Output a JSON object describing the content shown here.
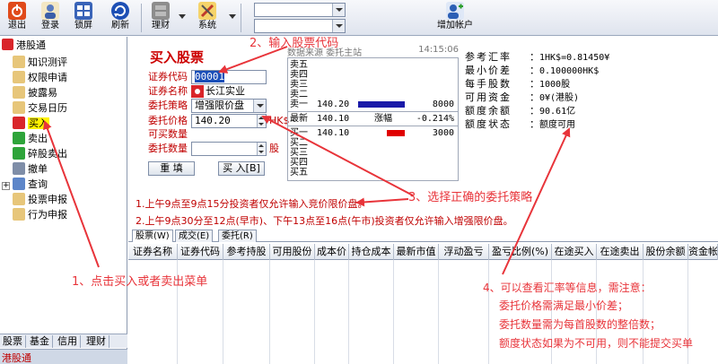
{
  "toolbar": {
    "buttons": [
      {
        "label": "退出",
        "icon": "power-icon"
      },
      {
        "label": "登录",
        "icon": "login-icon"
      },
      {
        "label": "锁屏",
        "icon": "lock-screen-icon"
      },
      {
        "label": "刷新",
        "icon": "refresh-icon"
      },
      {
        "label": "理财",
        "icon": "finance-icon"
      },
      {
        "label": "系统",
        "icon": "tools-icon"
      }
    ],
    "combo1": "",
    "combo2": "",
    "add_account": "增加帐户"
  },
  "tree": {
    "root": "港股通",
    "items": [
      "知识测评",
      "权限申请",
      "披露易",
      "交易日历",
      "买入",
      "卖出",
      "碎股卖出",
      "撤单",
      "查询",
      "投票申报",
      "行为申报"
    ],
    "selected": "买入"
  },
  "left_tabs": [
    "股票",
    "基金",
    "信用",
    "理财"
  ],
  "left_bottom": "港股通",
  "form": {
    "title": "买入股票",
    "code_label": "证券代码",
    "code_value": "00001",
    "name_label": "证券名称",
    "name_value": "长江实业",
    "strategy_label": "委托策略",
    "strategy_value": "增强限价盘",
    "price_label": "委托价格",
    "price_value": "140.20",
    "price_unit": "HK$",
    "max_label": "可买数量",
    "qty_label": "委托数量",
    "qty_value": "",
    "qty_unit": "股",
    "reset_button": "重 填",
    "buy_button": "买 入[B]"
  },
  "quote": {
    "source": "数据来源  委托主站",
    "time": "14:15:06",
    "sells": [
      {
        "label": "卖五",
        "price": "",
        "vol": ""
      },
      {
        "label": "卖四",
        "price": "",
        "vol": ""
      },
      {
        "label": "卖三",
        "price": "",
        "vol": ""
      },
      {
        "label": "卖二",
        "price": "",
        "vol": ""
      },
      {
        "label": "卖一",
        "price": "140.20",
        "vol": "8000"
      }
    ],
    "latest_label": "最新",
    "latest_price": "140.10",
    "change_label": "涨幅",
    "change_value": "-0.214%",
    "buys": [
      {
        "label": "买一",
        "price": "140.10",
        "vol": "3000"
      },
      {
        "label": "买二",
        "price": "",
        "vol": ""
      },
      {
        "label": "买三",
        "price": "",
        "vol": ""
      },
      {
        "label": "买四",
        "price": "",
        "vol": ""
      },
      {
        "label": "买五",
        "price": "",
        "vol": ""
      }
    ]
  },
  "info": [
    {
      "k": "参考汇率",
      "v": "1HK$=0.81450¥"
    },
    {
      "k": "最小价差",
      "v": "0.100000HK$"
    },
    {
      "k": "每手股数",
      "v": "1000股"
    },
    {
      "k": "可用资金",
      "v": "0¥(港股)"
    },
    {
      "k": "额度余额",
      "v": "90.61亿"
    },
    {
      "k": "额度状态",
      "v": "额度可用"
    }
  ],
  "notes": [
    "1.上午9点至9点15分投资者仅允许输入竞价限价盘。",
    "2.上午9点30分至12点(早市)、下午13点至16点(午市)投资者仅允许输入增强限价盘。"
  ],
  "tabs": [
    "股票(W)",
    "成交(E)",
    "委托(R)"
  ],
  "columns": [
    "证券名称",
    "证券代码",
    "参考持股",
    "可用股份",
    "成本价",
    "持仓成本",
    "最新市值",
    "浮动盈亏",
    "盈亏比例(%)",
    "在途买入",
    "在途卖出",
    "股份余额",
    "资金帐"
  ],
  "annotations": {
    "a1": "1、点击买入或者卖出菜单",
    "a2": "2、输入股票代码",
    "a3": "3、选择正确的委托策略",
    "a4_title": "4、可以查看汇率等信息，需注意：",
    "a4_lines": [
      "委托价格需满足最小价差；",
      "委托数量需为每首股数的整倍数；",
      "额度状态如果为不可用，则不能提交买单"
    ]
  },
  "colors": {
    "accent_red": "#e8343a",
    "label_red": "#c00000",
    "bar_blue": "#1a1aa8",
    "bar_red": "#e00000",
    "highlight": "#fff200"
  }
}
